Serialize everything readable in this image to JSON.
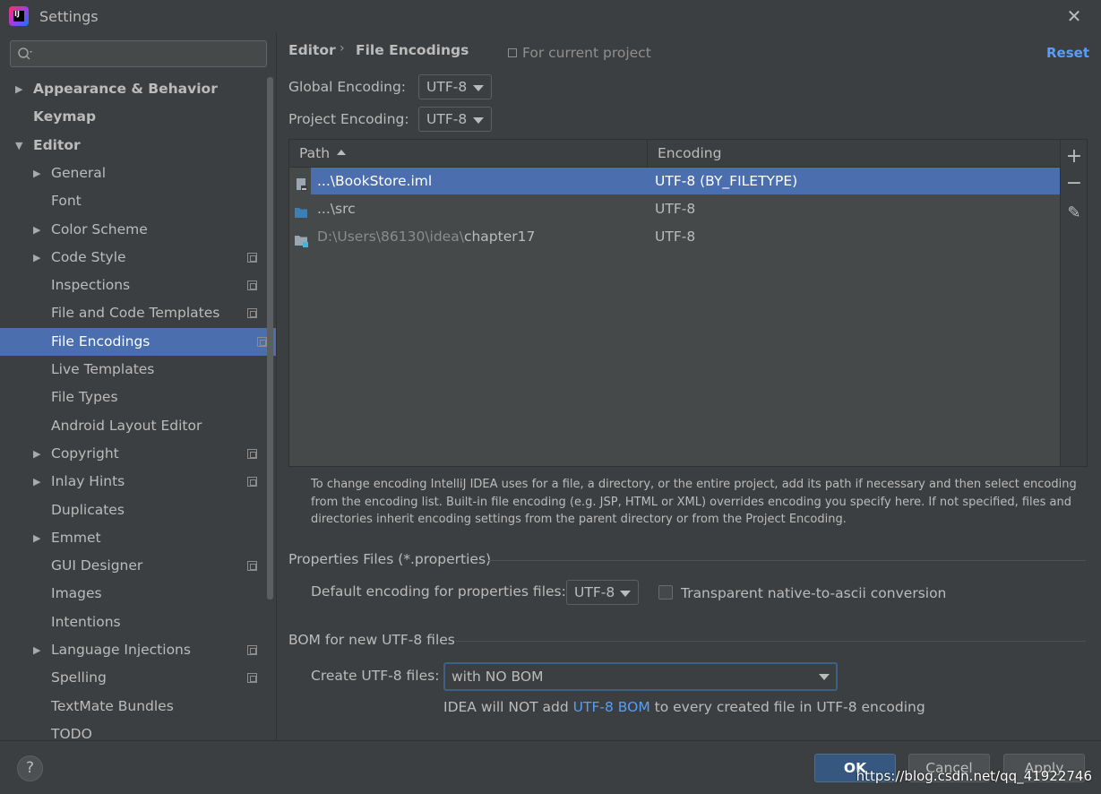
{
  "window": {
    "title": "Settings"
  },
  "search": {
    "placeholder": ""
  },
  "sidebar": {
    "items": [
      {
        "label": "Appearance & Behavior",
        "level": 0,
        "expandable": true,
        "expanded": false,
        "bold": true,
        "project_icon": false
      },
      {
        "label": "Keymap",
        "level": 0,
        "expandable": false,
        "bold": true,
        "project_icon": false
      },
      {
        "label": "Editor",
        "level": 0,
        "expandable": true,
        "expanded": true,
        "bold": true,
        "project_icon": false
      },
      {
        "label": "General",
        "level": 1,
        "expandable": true,
        "expanded": false,
        "project_icon": false
      },
      {
        "label": "Font",
        "level": 1,
        "expandable": false,
        "project_icon": false
      },
      {
        "label": "Color Scheme",
        "level": 1,
        "expandable": true,
        "expanded": false,
        "project_icon": false
      },
      {
        "label": "Code Style",
        "level": 1,
        "expandable": true,
        "expanded": false,
        "project_icon": true
      },
      {
        "label": "Inspections",
        "level": 1,
        "expandable": false,
        "project_icon": true
      },
      {
        "label": "File and Code Templates",
        "level": 1,
        "expandable": false,
        "project_icon": true
      },
      {
        "label": "File Encodings",
        "level": 1,
        "expandable": false,
        "project_icon": true,
        "selected": true
      },
      {
        "label": "Live Templates",
        "level": 1,
        "expandable": false,
        "project_icon": false
      },
      {
        "label": "File Types",
        "level": 1,
        "expandable": false,
        "project_icon": false
      },
      {
        "label": "Android Layout Editor",
        "level": 1,
        "expandable": false,
        "project_icon": false
      },
      {
        "label": "Copyright",
        "level": 1,
        "expandable": true,
        "expanded": false,
        "project_icon": true
      },
      {
        "label": "Inlay Hints",
        "level": 1,
        "expandable": true,
        "expanded": false,
        "project_icon": true
      },
      {
        "label": "Duplicates",
        "level": 1,
        "expandable": false,
        "project_icon": false
      },
      {
        "label": "Emmet",
        "level": 1,
        "expandable": true,
        "expanded": false,
        "project_icon": false
      },
      {
        "label": "GUI Designer",
        "level": 1,
        "expandable": false,
        "project_icon": true
      },
      {
        "label": "Images",
        "level": 1,
        "expandable": false,
        "project_icon": false
      },
      {
        "label": "Intentions",
        "level": 1,
        "expandable": false,
        "project_icon": false
      },
      {
        "label": "Language Injections",
        "level": 1,
        "expandable": true,
        "expanded": false,
        "project_icon": true
      },
      {
        "label": "Spelling",
        "level": 1,
        "expandable": false,
        "project_icon": true
      },
      {
        "label": "TextMate Bundles",
        "level": 1,
        "expandable": false,
        "project_icon": false
      },
      {
        "label": "TODO",
        "level": 1,
        "expandable": false,
        "project_icon": false
      }
    ]
  },
  "header": {
    "breadcrumb_parent": "Editor",
    "breadcrumb_separator": "›",
    "breadcrumb_current": "File Encodings",
    "scope_note": "For current project",
    "reset_label": "Reset"
  },
  "global_encoding": {
    "label": "Global Encoding:",
    "value": "UTF-8"
  },
  "project_encoding": {
    "label": "Project Encoding:",
    "value": "UTF-8"
  },
  "table": {
    "columns": [
      "Path",
      "Encoding"
    ],
    "sort_column": "Path",
    "sort_direction": "ascending",
    "rows": [
      {
        "path_prefix": "",
        "path": "...\\BookStore.iml",
        "encoding": "UTF-8 (BY_FILETYPE)",
        "icon": "module-file-icon",
        "selected": true
      },
      {
        "path_prefix": "",
        "path": "...\\src",
        "encoding": "UTF-8",
        "icon": "folder-icon",
        "selected": false
      },
      {
        "path_prefix": "D:\\Users\\86130\\idea\\",
        "path": "chapter17",
        "encoding": "UTF-8",
        "icon": "module-folder-icon",
        "selected": false
      }
    ]
  },
  "toolbar": {
    "add": "+",
    "remove": "−",
    "edit": "✎"
  },
  "info_text": "To change encoding IntelliJ IDEA uses for a file, a directory, or the entire project, add its path if necessary and then select encoding from the encoding list. Built-in file encoding (e.g. JSP, HTML or XML) overrides encoding you specify here. If not specified, files and directories inherit encoding settings from the parent directory or from the Project Encoding.",
  "properties": {
    "section_title": "Properties Files (*.properties)",
    "default_label": "Default encoding for properties files:",
    "default_value": "UTF-8",
    "transparent_label": "Transparent native-to-ascii conversion",
    "transparent_checked": false
  },
  "bom": {
    "section_title": "BOM for new UTF-8 files",
    "create_label": "Create UTF-8 files:",
    "create_value": "with NO BOM",
    "note_before": "IDEA will NOT add ",
    "note_link": "UTF-8 BOM",
    "note_after": " to every created file in UTF-8 encoding"
  },
  "footer": {
    "help_label": "?",
    "ok_label": "OK",
    "cancel_label": "Cancel",
    "apply_label": "Apply",
    "watermark": "https://blog.csdn.net/qq_41922746"
  },
  "colors": {
    "background": "#3c3f41",
    "selection": "#4b6eaf",
    "link": "#589df6",
    "ok_button": "#365880"
  }
}
